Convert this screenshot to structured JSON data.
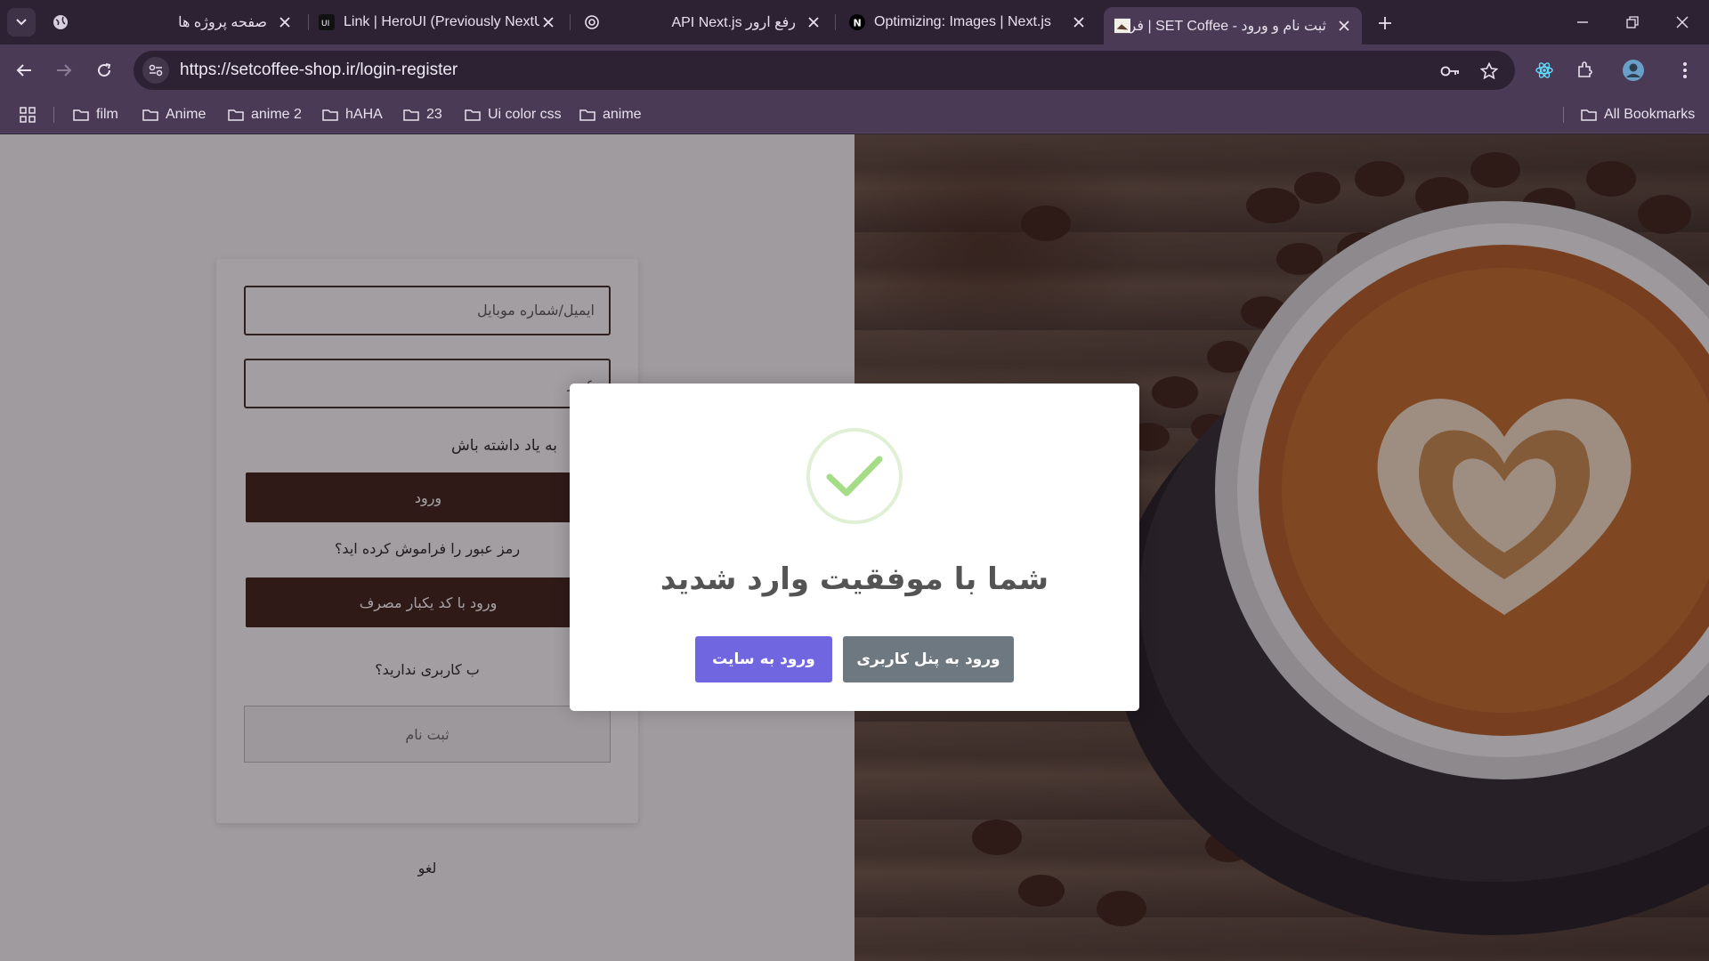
{
  "browser": {
    "tabs": [
      {
        "title": "صفحه پروژه ها",
        "icon": "globe-icon",
        "rtl": true
      },
      {
        "title": "Link | HeroUI (Previously NextUI)",
        "icon": "heroui-icon",
        "rtl": false
      },
      {
        "title": "رفع ارور API Next.js",
        "icon": "openai-icon",
        "rtl": true
      },
      {
        "title": "Optimizing: Images | Next.js",
        "icon": "nextjs-icon",
        "rtl": false
      },
      {
        "title": "ثبت نام و ورود - SET Coffee | فرو",
        "icon": "setcoffee-icon",
        "rtl": true,
        "active": true
      }
    ],
    "url": "https://setcoffee-shop.ir/login-register",
    "bookmarks": [
      "film",
      "Anime",
      "anime 2",
      "hAHA",
      "23",
      "Ui color css",
      "anime"
    ],
    "all_bookmarks": "All Bookmarks"
  },
  "login": {
    "email_placeholder": "ایمیل/شماره موبایل",
    "password_placeholder": "عبور",
    "remember": "به یاد داشته باش",
    "login_button": "ورود",
    "forgot": "رمز عبور را فراموش کرده اید؟",
    "otp_button": "ورود با کد یکبار مصرف",
    "no_account": "ب کاربری ندارید؟",
    "register_button": "ثبت نام",
    "cancel": "لغو"
  },
  "modal": {
    "title": "شما با موفقیت وارد شدید",
    "site_button": "ورود به سایت",
    "panel_button": "ورود به پنل کاربری"
  },
  "colors": {
    "primary": "#7066e0",
    "secondary": "#6e7881",
    "dark_button": "#3b1f14",
    "success": "#a5dc86"
  }
}
